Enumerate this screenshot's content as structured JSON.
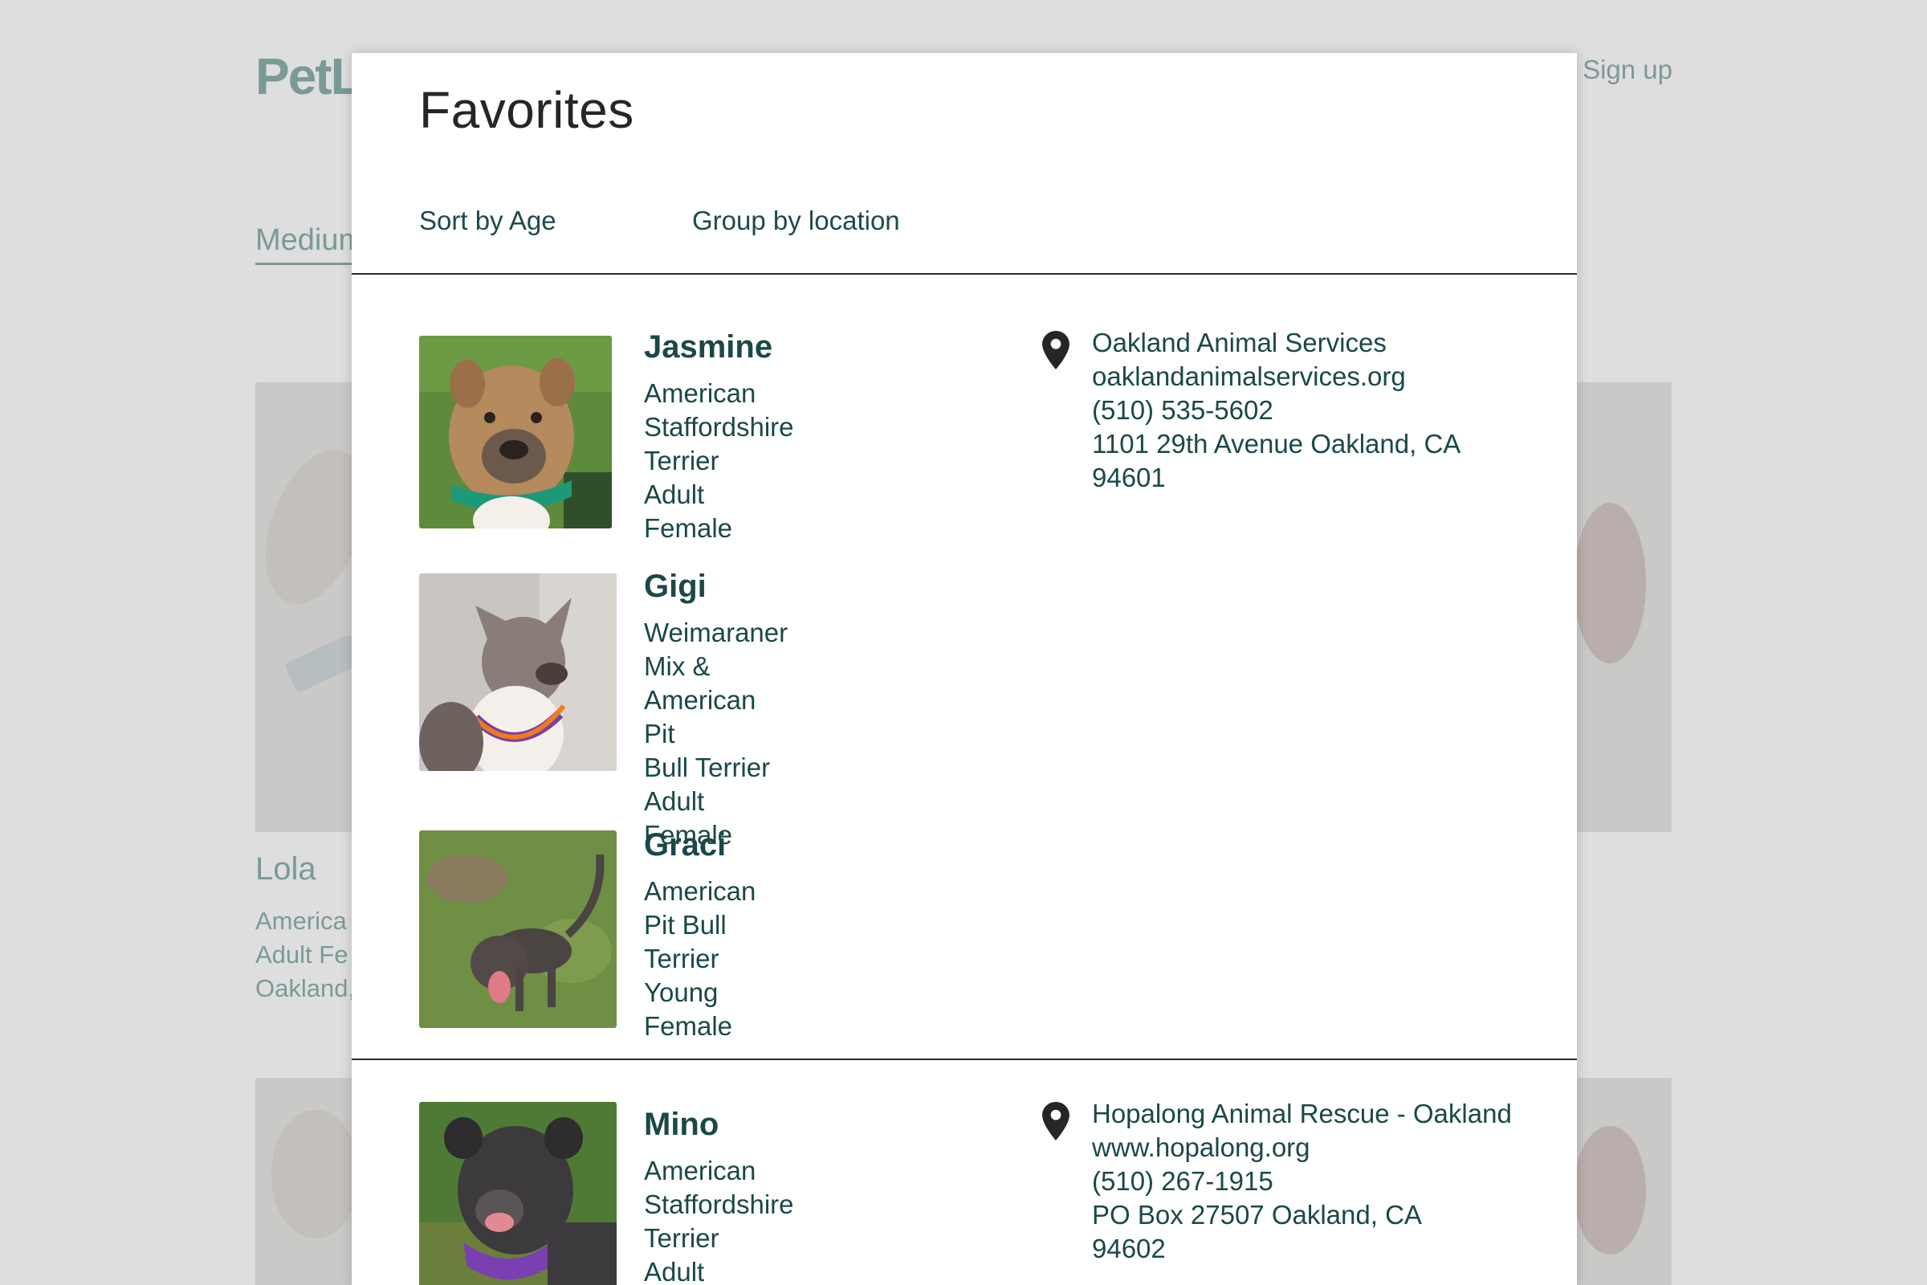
{
  "background": {
    "logo": "PetL",
    "signup": "Sign up",
    "tab": "Medium",
    "pet_name": "Lola",
    "pet_lines": [
      "America",
      "Adult Fe",
      "Oakland,"
    ]
  },
  "modal": {
    "title": "Favorites",
    "sort_label": "Sort by Age",
    "group_label": "Group by location"
  },
  "groups": [
    {
      "location": {
        "name": "Oakland Animal Services",
        "website": "oaklandanimalservices.org",
        "phone": "(510) 535-5602",
        "address_line1": "1101 29th Avenue Oakland, CA",
        "address_line2": "94601"
      },
      "pets": [
        {
          "name": "Jasmine",
          "breed": "American Staffordshire Terrier",
          "details": "Adult Female"
        },
        {
          "name": "Gigi",
          "breed_line1": "Weimaraner Mix & American Pit",
          "breed_line2": "Bull Terrier",
          "details": "Adult Female"
        },
        {
          "name": "Graci",
          "breed": "American Pit Bull Terrier",
          "details": "Young Female"
        }
      ]
    },
    {
      "location": {
        "name": "Hopalong Animal Rescue - Oakland",
        "website": "www.hopalong.org",
        "phone": "(510) 267-1915",
        "address_line1": "PO Box 27507 Oakland, CA",
        "address_line2": "94602"
      },
      "pets": [
        {
          "name": "Mino",
          "breed": "American Staffordshire Terrier",
          "details": "Adult Female"
        }
      ]
    }
  ],
  "icons": {
    "location": "map-pin-icon"
  },
  "colors": {
    "text_teal": "#1b4848",
    "overlay_bg": "#dedede",
    "modal_bg": "#ffffff"
  }
}
